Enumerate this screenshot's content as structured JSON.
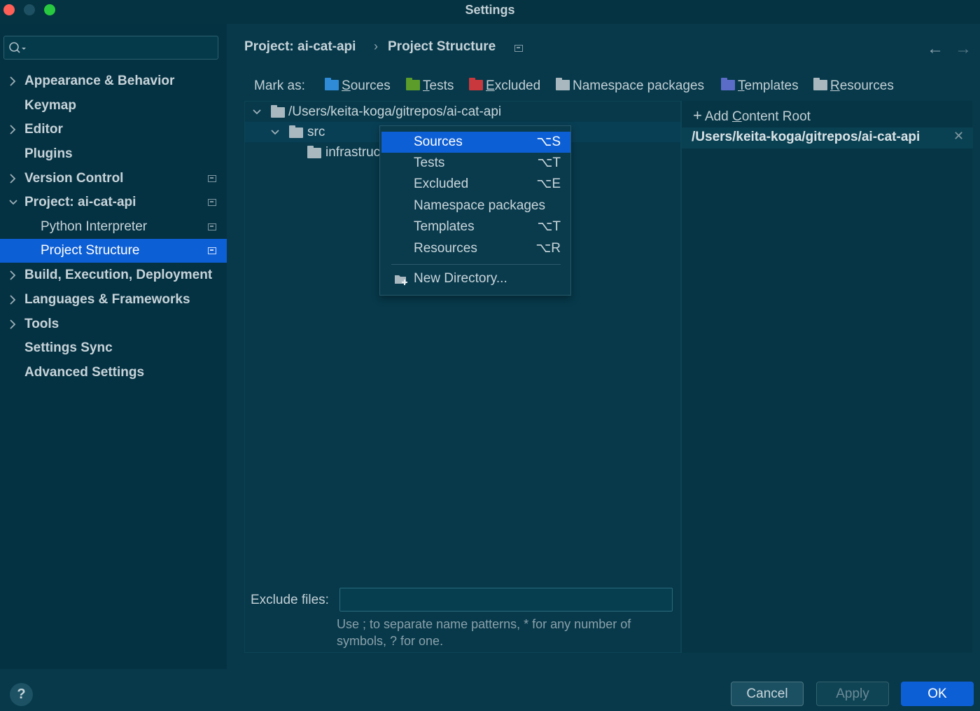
{
  "window": {
    "title": "Settings"
  },
  "sidebar": {
    "search_placeholder": "",
    "items": [
      {
        "label": "Appearance & Behavior",
        "expandable": true
      },
      {
        "label": "Keymap",
        "expandable": false
      },
      {
        "label": "Editor",
        "expandable": true
      },
      {
        "label": "Plugins",
        "expandable": false
      },
      {
        "label": "Version Control",
        "expandable": true
      },
      {
        "label": "Project: ai-cat-api",
        "expandable": true,
        "expanded": true
      },
      {
        "label": "Python Interpreter",
        "sub": true
      },
      {
        "label": "Project Structure",
        "sub": true,
        "selected": true
      },
      {
        "label": "Build, Execution, Deployment",
        "expandable": true
      },
      {
        "label": "Languages & Frameworks",
        "expandable": true
      },
      {
        "label": "Tools",
        "expandable": true
      },
      {
        "label": "Settings Sync",
        "expandable": false
      },
      {
        "label": "Advanced Settings",
        "expandable": false
      }
    ]
  },
  "breadcrumb": {
    "project": "Project: ai-cat-api",
    "separator": "›",
    "page": "Project Structure"
  },
  "nav": {
    "back": "←",
    "forward": "→"
  },
  "mark_as": {
    "label": "Mark as:",
    "buttons": [
      {
        "key": "S",
        "rest": "ources",
        "color": "#2f8ad8"
      },
      {
        "key": "T",
        "rest": "ests",
        "color": "#5b9c2a"
      },
      {
        "key": "E",
        "rest": "xcluded",
        "color": "#c8383c"
      },
      {
        "key": "",
        "rest": "Namespace packages",
        "color": "#a9b8bf"
      },
      {
        "key": "T",
        "rest": "emplates",
        "color": "#5a6cc8"
      },
      {
        "key": "R",
        "rest": "esources",
        "color": "#a9b8bf"
      }
    ]
  },
  "tree": {
    "root": "/Users/keita-koga/gitrepos/ai-cat-api",
    "src": "src",
    "child": "infrastruc"
  },
  "context_menu": {
    "items": [
      {
        "label": "Sources",
        "shortcut": "⌥S"
      },
      {
        "label": "Tests",
        "shortcut": "⌥T"
      },
      {
        "label": "Excluded",
        "shortcut": "⌥E"
      },
      {
        "label": "Namespace packages",
        "shortcut": ""
      },
      {
        "label": "Templates",
        "shortcut": "⌥T"
      },
      {
        "label": "Resources",
        "shortcut": "⌥R"
      }
    ],
    "new_directory": "New Directory..."
  },
  "content_roots": {
    "add_label_pre": "Add ",
    "add_label_key": "C",
    "add_label_post": "ontent Root",
    "path": "/Users/keita-koga/gitrepos/ai-cat-api"
  },
  "exclude": {
    "label": "Exclude files:",
    "value": "",
    "hint": "Use ; to separate name patterns, * for any number of symbols, ? for one."
  },
  "buttons": {
    "cancel": "Cancel",
    "apply": "Apply",
    "ok": "OK",
    "help": "?"
  }
}
